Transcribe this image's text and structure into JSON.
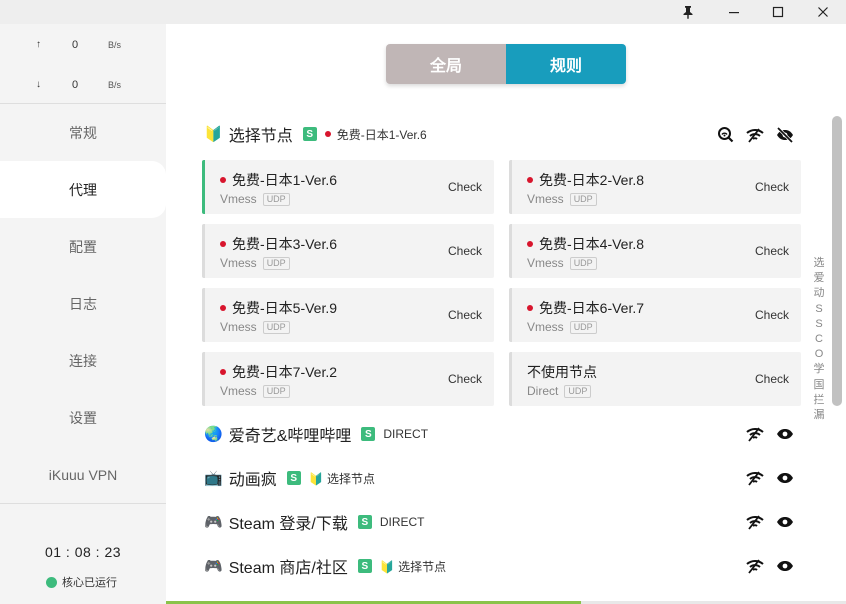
{
  "window": {
    "pin_icon": "pin-icon",
    "minimize_icon": "minimize-icon",
    "maximize_icon": "maximize-icon",
    "close_icon": "close-icon"
  },
  "traffic": {
    "up_arrow": "↑",
    "up_value": "0",
    "up_unit": "B/s",
    "down_arrow": "↓",
    "down_value": "0",
    "down_unit": "B/s"
  },
  "nav": {
    "general": "常规",
    "proxy": "代理",
    "profiles": "配置",
    "logs": "日志",
    "connections": "连接",
    "settings": "设置",
    "provider": "iKuuu VPN"
  },
  "status": {
    "uptime": "01 : 08 : 23",
    "core_text": "核心已运行",
    "core_color": "#3dbb7d"
  },
  "mode": {
    "global": "全局",
    "rule": "规则",
    "selected": "rule"
  },
  "groups": [
    {
      "emoji": "🔰",
      "name": "选择节点",
      "badge": "S",
      "selected": "免费-日本1-Ver.6"
    },
    {
      "emoji": "🌏",
      "name": "爱奇艺&哔哩哔哩",
      "badge": "S",
      "selected": "DIRECT"
    },
    {
      "emoji": "📺",
      "name": "动画疯",
      "badge": "S",
      "selected": "🔰 选择节点"
    },
    {
      "emoji": "🎮",
      "name": "Steam 登录/下载",
      "badge": "S",
      "selected": "DIRECT"
    },
    {
      "emoji": "🎮",
      "name": "Steam 商店/社区",
      "badge": "S",
      "selected": "🔰 选择节点"
    }
  ],
  "nodes": [
    {
      "name": "免费-日本1-Ver.6",
      "type": "Vmess",
      "udp": "UDP",
      "check": "Check"
    },
    {
      "name": "免费-日本2-Ver.8",
      "type": "Vmess",
      "udp": "UDP",
      "check": "Check"
    },
    {
      "name": "免费-日本3-Ver.6",
      "type": "Vmess",
      "udp": "UDP",
      "check": "Check"
    },
    {
      "name": "免费-日本4-Ver.8",
      "type": "Vmess",
      "udp": "UDP",
      "check": "Check"
    },
    {
      "name": "免费-日本5-Ver.9",
      "type": "Vmess",
      "udp": "UDP",
      "check": "Check"
    },
    {
      "name": "免费-日本6-Ver.7",
      "type": "Vmess",
      "udp": "UDP",
      "check": "Check"
    },
    {
      "name": "免费-日本7-Ver.2",
      "type": "Vmess",
      "udp": "UDP",
      "check": "Check"
    },
    {
      "name": "不使用节点",
      "type": "Direct",
      "udp": "UDP",
      "check": "Check"
    }
  ],
  "side_index": [
    "选",
    "爱",
    "动",
    "S",
    "S",
    "C",
    "O",
    "学",
    "国",
    "拦",
    "漏"
  ],
  "colors": {
    "accent": "#189dbd",
    "inactive_mode": "#c0b6b6",
    "badge": "#3dbb7d",
    "japan_flag": "#d8152d",
    "active_node": "#3dbb7d"
  },
  "progress_fraction": 0.61
}
